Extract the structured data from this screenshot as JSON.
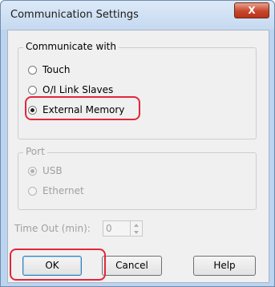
{
  "dialog": {
    "title": "Communication Settings",
    "close_symbol": "X"
  },
  "communicate_with": {
    "legend": "Communicate with",
    "options": [
      {
        "label": "Touch",
        "checked": false
      },
      {
        "label": "O/I Link Slaves",
        "checked": false
      },
      {
        "label": "External Memory",
        "checked": true
      }
    ]
  },
  "port": {
    "legend": "Port",
    "enabled": false,
    "options": [
      {
        "label": "USB",
        "checked": true
      },
      {
        "label": "Ethernet",
        "checked": false
      }
    ]
  },
  "timeout": {
    "label": "Time Out (min):",
    "value": "0"
  },
  "buttons": {
    "ok": "OK",
    "cancel": "Cancel",
    "help": "Help"
  },
  "colors": {
    "annotation_highlight": "#e2273b",
    "close_button": "#c8452b"
  }
}
